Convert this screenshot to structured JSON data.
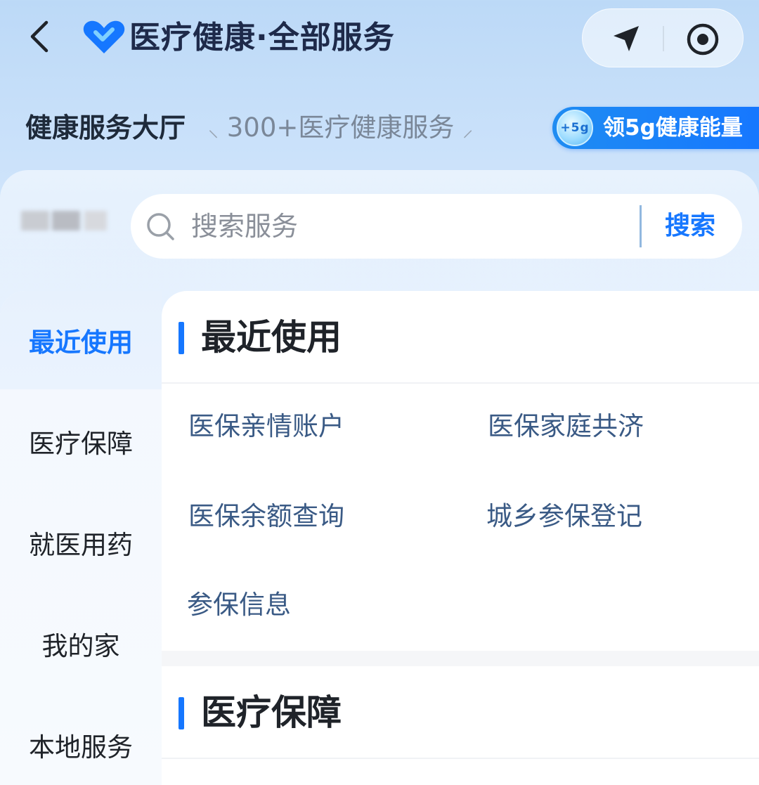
{
  "header": {
    "title": "医疗健康·全部服务",
    "back_icon": "chevron-left-icon",
    "brand_icon": "heart-logo-icon",
    "location_icon": "navigation-arrow-icon",
    "target_icon": "record-target-icon"
  },
  "hall": {
    "title": "健康服务大厅",
    "subtitle": "300+医疗健康服务",
    "energy_coin": "+5g",
    "energy_label": "领5g健康能量"
  },
  "search": {
    "placeholder": "搜索服务",
    "button_label": "搜索"
  },
  "nav": {
    "items": [
      {
        "label": "最近使用",
        "active": true
      },
      {
        "label": "医疗保障",
        "active": false
      },
      {
        "label": "就医用药",
        "active": false
      },
      {
        "label": "我的家",
        "active": false
      },
      {
        "label": "本地服务",
        "active": false
      }
    ]
  },
  "sections": [
    {
      "title": "最近使用",
      "links": [
        "医保亲情账户",
        "医保家庭共济",
        "医保余额查询",
        "城乡参保登记",
        "参保信息"
      ]
    },
    {
      "title": "医疗保障",
      "links": []
    }
  ],
  "colors": {
    "accent": "#1677ff",
    "link": "#3a5a85",
    "title": "#1f2329"
  }
}
